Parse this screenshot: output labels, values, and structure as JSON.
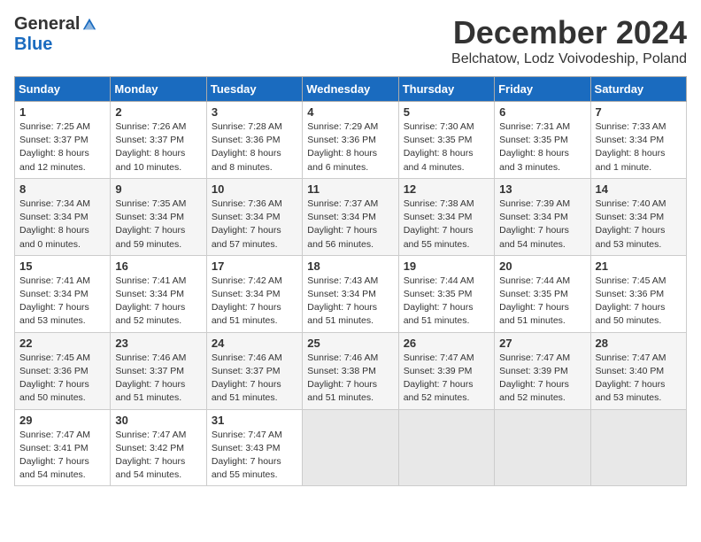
{
  "header": {
    "logo_general": "General",
    "logo_blue": "Blue",
    "month_title": "December 2024",
    "location": "Belchatow, Lodz Voivodeship, Poland"
  },
  "weekdays": [
    "Sunday",
    "Monday",
    "Tuesday",
    "Wednesday",
    "Thursday",
    "Friday",
    "Saturday"
  ],
  "weeks": [
    [
      {
        "day": "1",
        "sunrise": "Sunrise: 7:25 AM",
        "sunset": "Sunset: 3:37 PM",
        "daylight": "Daylight: 8 hours and 12 minutes."
      },
      {
        "day": "2",
        "sunrise": "Sunrise: 7:26 AM",
        "sunset": "Sunset: 3:37 PM",
        "daylight": "Daylight: 8 hours and 10 minutes."
      },
      {
        "day": "3",
        "sunrise": "Sunrise: 7:28 AM",
        "sunset": "Sunset: 3:36 PM",
        "daylight": "Daylight: 8 hours and 8 minutes."
      },
      {
        "day": "4",
        "sunrise": "Sunrise: 7:29 AM",
        "sunset": "Sunset: 3:36 PM",
        "daylight": "Daylight: 8 hours and 6 minutes."
      },
      {
        "day": "5",
        "sunrise": "Sunrise: 7:30 AM",
        "sunset": "Sunset: 3:35 PM",
        "daylight": "Daylight: 8 hours and 4 minutes."
      },
      {
        "day": "6",
        "sunrise": "Sunrise: 7:31 AM",
        "sunset": "Sunset: 3:35 PM",
        "daylight": "Daylight: 8 hours and 3 minutes."
      },
      {
        "day": "7",
        "sunrise": "Sunrise: 7:33 AM",
        "sunset": "Sunset: 3:34 PM",
        "daylight": "Daylight: 8 hours and 1 minute."
      }
    ],
    [
      {
        "day": "8",
        "sunrise": "Sunrise: 7:34 AM",
        "sunset": "Sunset: 3:34 PM",
        "daylight": "Daylight: 8 hours and 0 minutes."
      },
      {
        "day": "9",
        "sunrise": "Sunrise: 7:35 AM",
        "sunset": "Sunset: 3:34 PM",
        "daylight": "Daylight: 7 hours and 59 minutes."
      },
      {
        "day": "10",
        "sunrise": "Sunrise: 7:36 AM",
        "sunset": "Sunset: 3:34 PM",
        "daylight": "Daylight: 7 hours and 57 minutes."
      },
      {
        "day": "11",
        "sunrise": "Sunrise: 7:37 AM",
        "sunset": "Sunset: 3:34 PM",
        "daylight": "Daylight: 7 hours and 56 minutes."
      },
      {
        "day": "12",
        "sunrise": "Sunrise: 7:38 AM",
        "sunset": "Sunset: 3:34 PM",
        "daylight": "Daylight: 7 hours and 55 minutes."
      },
      {
        "day": "13",
        "sunrise": "Sunrise: 7:39 AM",
        "sunset": "Sunset: 3:34 PM",
        "daylight": "Daylight: 7 hours and 54 minutes."
      },
      {
        "day": "14",
        "sunrise": "Sunrise: 7:40 AM",
        "sunset": "Sunset: 3:34 PM",
        "daylight": "Daylight: 7 hours and 53 minutes."
      }
    ],
    [
      {
        "day": "15",
        "sunrise": "Sunrise: 7:41 AM",
        "sunset": "Sunset: 3:34 PM",
        "daylight": "Daylight: 7 hours and 53 minutes."
      },
      {
        "day": "16",
        "sunrise": "Sunrise: 7:41 AM",
        "sunset": "Sunset: 3:34 PM",
        "daylight": "Daylight: 7 hours and 52 minutes."
      },
      {
        "day": "17",
        "sunrise": "Sunrise: 7:42 AM",
        "sunset": "Sunset: 3:34 PM",
        "daylight": "Daylight: 7 hours and 51 minutes."
      },
      {
        "day": "18",
        "sunrise": "Sunrise: 7:43 AM",
        "sunset": "Sunset: 3:34 PM",
        "daylight": "Daylight: 7 hours and 51 minutes."
      },
      {
        "day": "19",
        "sunrise": "Sunrise: 7:44 AM",
        "sunset": "Sunset: 3:35 PM",
        "daylight": "Daylight: 7 hours and 51 minutes."
      },
      {
        "day": "20",
        "sunrise": "Sunrise: 7:44 AM",
        "sunset": "Sunset: 3:35 PM",
        "daylight": "Daylight: 7 hours and 51 minutes."
      },
      {
        "day": "21",
        "sunrise": "Sunrise: 7:45 AM",
        "sunset": "Sunset: 3:36 PM",
        "daylight": "Daylight: 7 hours and 50 minutes."
      }
    ],
    [
      {
        "day": "22",
        "sunrise": "Sunrise: 7:45 AM",
        "sunset": "Sunset: 3:36 PM",
        "daylight": "Daylight: 7 hours and 50 minutes."
      },
      {
        "day": "23",
        "sunrise": "Sunrise: 7:46 AM",
        "sunset": "Sunset: 3:37 PM",
        "daylight": "Daylight: 7 hours and 51 minutes."
      },
      {
        "day": "24",
        "sunrise": "Sunrise: 7:46 AM",
        "sunset": "Sunset: 3:37 PM",
        "daylight": "Daylight: 7 hours and 51 minutes."
      },
      {
        "day": "25",
        "sunrise": "Sunrise: 7:46 AM",
        "sunset": "Sunset: 3:38 PM",
        "daylight": "Daylight: 7 hours and 51 minutes."
      },
      {
        "day": "26",
        "sunrise": "Sunrise: 7:47 AM",
        "sunset": "Sunset: 3:39 PM",
        "daylight": "Daylight: 7 hours and 52 minutes."
      },
      {
        "day": "27",
        "sunrise": "Sunrise: 7:47 AM",
        "sunset": "Sunset: 3:39 PM",
        "daylight": "Daylight: 7 hours and 52 minutes."
      },
      {
        "day": "28",
        "sunrise": "Sunrise: 7:47 AM",
        "sunset": "Sunset: 3:40 PM",
        "daylight": "Daylight: 7 hours and 53 minutes."
      }
    ],
    [
      {
        "day": "29",
        "sunrise": "Sunrise: 7:47 AM",
        "sunset": "Sunset: 3:41 PM",
        "daylight": "Daylight: 7 hours and 54 minutes."
      },
      {
        "day": "30",
        "sunrise": "Sunrise: 7:47 AM",
        "sunset": "Sunset: 3:42 PM",
        "daylight": "Daylight: 7 hours and 54 minutes."
      },
      {
        "day": "31",
        "sunrise": "Sunrise: 7:47 AM",
        "sunset": "Sunset: 3:43 PM",
        "daylight": "Daylight: 7 hours and 55 minutes."
      },
      null,
      null,
      null,
      null
    ]
  ]
}
